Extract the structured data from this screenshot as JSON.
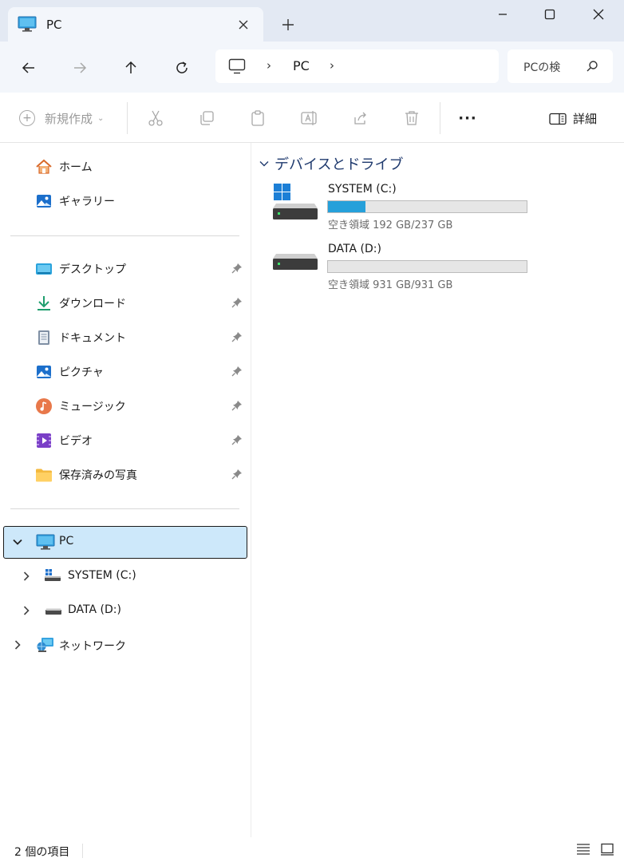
{
  "colors": {
    "accent": "#26a0da",
    "selection": "#cde8fa",
    "titlebar": "#e3e9f3"
  },
  "tab": {
    "title": "PC"
  },
  "address": {
    "location": "PC",
    "separator": "›"
  },
  "search": {
    "placeholder": "PCの検"
  },
  "toolbar": {
    "new_label": "新規作成",
    "details_label": "詳細",
    "more_label": "···"
  },
  "sidebar": {
    "quick": [
      {
        "label": "ホーム",
        "icon": "home-icon"
      },
      {
        "label": "ギャラリー",
        "icon": "gallery-icon"
      }
    ],
    "pinned": [
      {
        "label": "デスクトップ",
        "icon": "desktop-icon"
      },
      {
        "label": "ダウンロード",
        "icon": "download-icon"
      },
      {
        "label": "ドキュメント",
        "icon": "document-icon"
      },
      {
        "label": "ピクチャ",
        "icon": "pictures-icon"
      },
      {
        "label": "ミュージック",
        "icon": "music-icon"
      },
      {
        "label": "ビデオ",
        "icon": "video-icon"
      },
      {
        "label": "保存済みの写真",
        "icon": "folder-icon"
      }
    ],
    "tree": {
      "pc": "PC",
      "drives": [
        "SYSTEM (C:)",
        "DATA (D:)"
      ],
      "network": "ネットワーク"
    }
  },
  "main": {
    "group_title": "デバイスとドライブ",
    "drives": [
      {
        "name": "SYSTEM (C:)",
        "free_text": "空き領域 192 GB/237 GB",
        "used_fraction": 0.19
      },
      {
        "name": "DATA (D:)",
        "free_text": "空き領域 931 GB/931 GB",
        "used_fraction": 0.0
      }
    ]
  },
  "status": {
    "item_count": "2 個の項目"
  }
}
